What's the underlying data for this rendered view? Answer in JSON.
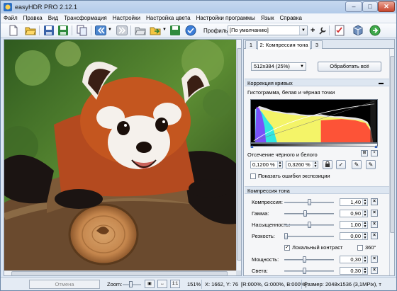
{
  "window": {
    "title": "easyHDR PRO 2.12.1"
  },
  "menu": [
    "Файл",
    "Правка",
    "Вид",
    "Трансформация",
    "Настройки",
    "Настройка цвета",
    "Настройки программы",
    "Язык",
    "Справка"
  ],
  "toolbar": {
    "profile_label": "Профиль:",
    "profile_value": "[По умолчанию]"
  },
  "panel": {
    "tabs": [
      "1",
      "2: Компрессия тона",
      "3"
    ],
    "preview_size": "512x384 (25%)",
    "process_all": "Обработать всё",
    "curve_correction": "Коррекция кривых",
    "histogram_title": "Гистограмма, белая и чёрная точки",
    "clip_title": "Отсечение чёрного и белого",
    "clip_black": "0,1200 %",
    "clip_white": "0,3260 %",
    "show_exposure_errors": "Показать ошибки экспозиции",
    "tone_compression": "Компрессия тона",
    "sliders": [
      {
        "label": "Компрессия:",
        "value": "1,40",
        "pos": 0.5
      },
      {
        "label": "Гамма:",
        "value": "0,90",
        "pos": 0.42
      },
      {
        "label": "Насыщенность:",
        "value": "1,00",
        "pos": 0.5
      },
      {
        "label": "Резкость:",
        "value": "0,00",
        "pos": 0.0
      }
    ],
    "local_contrast": "Локальный контраст",
    "deg360": "360°",
    "sliders2": [
      {
        "label": "Мощность:",
        "value": "0,30",
        "pos": 0.4
      },
      {
        "label": "Света:",
        "value": "0,30",
        "pos": 0.4
      }
    ]
  },
  "status": {
    "cancel": "Отмена",
    "zoom": "Zoom:",
    "zoom_percent": "151%",
    "coords": "X: 1662, Y: 76",
    "rgb": "[R:000%, G:000%, B:000%]",
    "size": "Размер: 2048x1536 (3,1MPix), т"
  },
  "colors": {
    "accent": "#dde6f1"
  }
}
